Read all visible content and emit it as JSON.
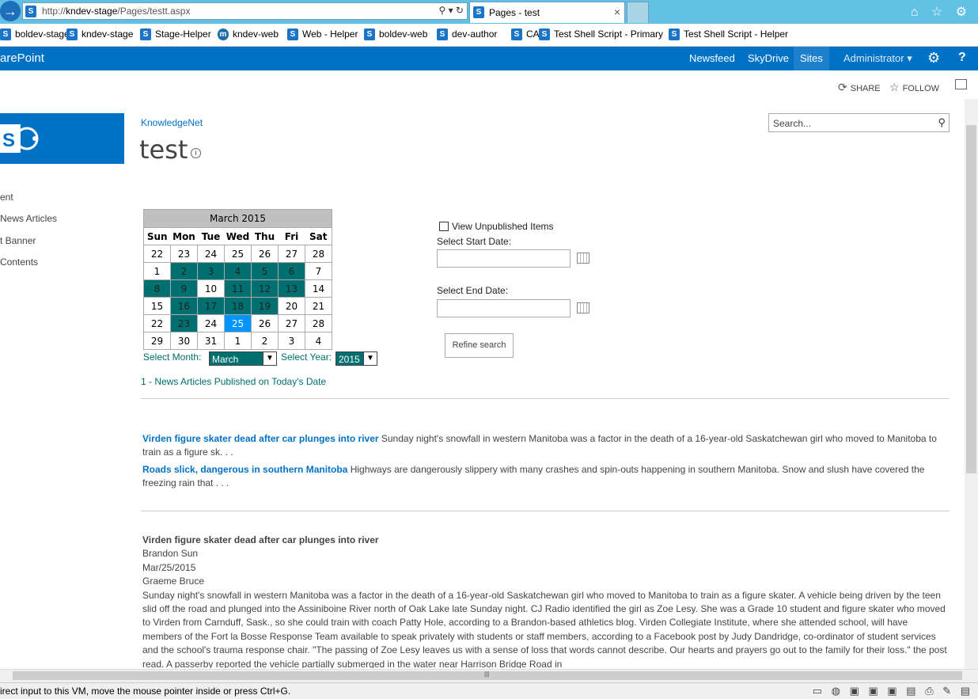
{
  "browser": {
    "url_prefix": "http://",
    "url_host": "kndev-stage",
    "url_path": "/Pages/testt.aspx",
    "url_controls": "⚲ ▾ ↻",
    "tab_title": "Pages - test",
    "icons": "⌂ ☆ ⚙"
  },
  "favorites": [
    {
      "label": "boldev-stage",
      "icon": "sp"
    },
    {
      "label": "kndev-stage",
      "icon": "sp"
    },
    {
      "label": "Stage-Helper",
      "icon": "sp"
    },
    {
      "label": "kndev-web",
      "icon": "m"
    },
    {
      "label": "Web - Helper",
      "icon": "sp"
    },
    {
      "label": "boldev-web",
      "icon": "sp"
    },
    {
      "label": "dev-author",
      "icon": "sp"
    },
    {
      "label": "CA",
      "icon": "sp"
    },
    {
      "label": "Test Shell Script - Primary",
      "icon": "sp"
    },
    {
      "label": "Test Shell Script - Helper",
      "icon": "sp"
    }
  ],
  "suite": {
    "brand": "arePoint",
    "links": [
      "Newsfeed",
      "SkyDrive",
      "Sites"
    ],
    "active_link": "Sites",
    "admin": "Administrator ▾",
    "gear": "⚙",
    "help": "?"
  },
  "actions": {
    "share": "SHARE",
    "follow": "FOLLOW"
  },
  "site": {
    "breadcrumb": "KnowledgeNet",
    "title": "test",
    "info": "i",
    "search_placeholder": "Search..."
  },
  "quick_nav": [
    "ent",
    "News Articles",
    "t Banner",
    " Contents"
  ],
  "calendar": {
    "caption": "March 2015",
    "days": [
      "Sun",
      "Mon",
      "Tue",
      "Wed",
      "Thu",
      "Fri",
      "Sat"
    ],
    "weeks": [
      [
        {
          "d": "22",
          "s": "n"
        },
        {
          "d": "23",
          "s": "n"
        },
        {
          "d": "24",
          "s": "n"
        },
        {
          "d": "25",
          "s": "n"
        },
        {
          "d": "26",
          "s": "n"
        },
        {
          "d": "27",
          "s": "n"
        },
        {
          "d": "28",
          "s": "n"
        }
      ],
      [
        {
          "d": "1",
          "s": "n"
        },
        {
          "d": "2",
          "s": "h"
        },
        {
          "d": "3",
          "s": "h"
        },
        {
          "d": "4",
          "s": "h"
        },
        {
          "d": "5",
          "s": "h"
        },
        {
          "d": "6",
          "s": "h"
        },
        {
          "d": "7",
          "s": "n"
        }
      ],
      [
        {
          "d": "8",
          "s": "h"
        },
        {
          "d": "9",
          "s": "h"
        },
        {
          "d": "10",
          "s": "n"
        },
        {
          "d": "11",
          "s": "h"
        },
        {
          "d": "12",
          "s": "h"
        },
        {
          "d": "13",
          "s": "h"
        },
        {
          "d": "14",
          "s": "n"
        }
      ],
      [
        {
          "d": "15",
          "s": "n"
        },
        {
          "d": "16",
          "s": "h"
        },
        {
          "d": "17",
          "s": "h"
        },
        {
          "d": "18",
          "s": "h"
        },
        {
          "d": "19",
          "s": "h"
        },
        {
          "d": "20",
          "s": "n"
        },
        {
          "d": "21",
          "s": "n"
        }
      ],
      [
        {
          "d": "22",
          "s": "n"
        },
        {
          "d": "23",
          "s": "h"
        },
        {
          "d": "24",
          "s": "n"
        },
        {
          "d": "25",
          "s": "t"
        },
        {
          "d": "26",
          "s": "n"
        },
        {
          "d": "27",
          "s": "n"
        },
        {
          "d": "28",
          "s": "n"
        }
      ],
      [
        {
          "d": "29",
          "s": "n"
        },
        {
          "d": "30",
          "s": "n"
        },
        {
          "d": "31",
          "s": "n"
        },
        {
          "d": "1",
          "s": "n"
        },
        {
          "d": "2",
          "s": "n"
        },
        {
          "d": "3",
          "s": "n"
        },
        {
          "d": "4",
          "s": "n"
        }
      ]
    ],
    "select_month_label": "Select Month:",
    "month_value": "March",
    "select_year_label": "Select Year:",
    "year_value": "2015",
    "highlight_color": "#006f6f",
    "today_color": "#0094ff"
  },
  "filters": {
    "view_unpublished": "View Unpublished Items",
    "start_label": "Select Start Date:",
    "end_label": "Select End Date:",
    "refine_button": "Refine search"
  },
  "news_link": "1 - News Articles Published on Today's Date",
  "articles": [
    {
      "title": "Virden figure skater dead after car plunges into river",
      "summary": " Sunday night's snowfall in western Manitoba was a factor in the death of a 16-year-old Saskatchewan girl who moved to Manitoba to train as a figure sk. . ."
    },
    {
      "title": "Roads slick, dangerous in southern Manitoba",
      "summary": " Highways are dangerously slippery with many crashes and spin-outs happening in southern Manitoba. Snow and slush have covered the freezing rain that . . ."
    }
  ],
  "detail": {
    "title": "Virden figure skater dead after car plunges into river",
    "source": "Brandon Sun",
    "date": "Mar/25/2015",
    "author": "Graeme Bruce",
    "body": "Sunday night's snowfall in western Manitoba was a factor in the death of a 16-year-old Saskatchewan girl who moved to Manitoba to train as a figure skater. A vehicle being driven by the teen slid off the road and plunged into the Assiniboine River north of Oak Lake late Sunday night. CJ Radio identified the girl as Zoe Lesy. She was a Grade 10 student and figure skater who moved to Virden from Carnduff, Sask., so she could train with coach Patty Hole, according to a Brandon-based athletics blog. Virden Collegiate Institute, where she attended school, will have members of the Fort la Bosse Response Team available to speak privately with students or staff members, according to a Facebook post by Judy Dandridge, co-ordinator of student services and the school's trauma response chair. \"The passing of Zoe Lesy leaves us with a sense of loss that words cannot describe. Our hearts and prayers go out to the family for their loss.\" the post read. A passerby reported the vehicle partially submerged in the water near Harrison Bridge Road in"
  },
  "status": {
    "text": "irect input to this VM, move the mouse pointer inside or press Ctrl+G.",
    "tray": "▭ ◍ ▣ ▣ ▣ ▤ ⎙ ✎ ▤"
  },
  "scroll_grip": "|||"
}
